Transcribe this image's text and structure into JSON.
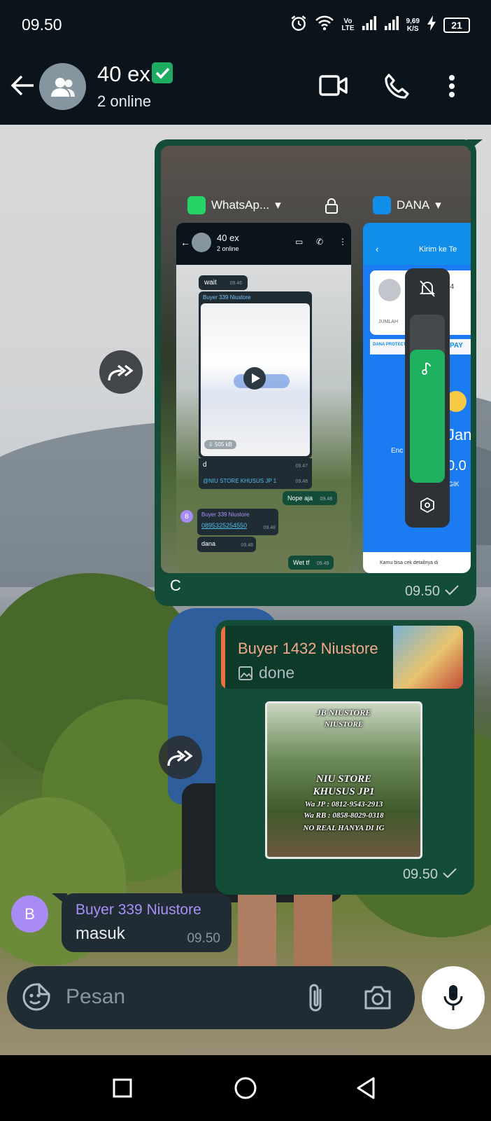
{
  "status_bar": {
    "time": "09.50",
    "network_label_top": "Vo",
    "network_label_bottom": "LTE",
    "speed_value": "9,69",
    "speed_unit": "K/S",
    "battery": "21"
  },
  "header": {
    "title": "40 ex",
    "subtitle": "2 online"
  },
  "messages": {
    "forwarded_screenshot": {
      "tabs": {
        "left": "WhatsAp...",
        "right": "DANA"
      },
      "inner_chat": {
        "title": "40 ex",
        "subtitle": "2 online",
        "msg_wait": "wait",
        "msg_wait_time": "09.46",
        "video_sender": "Buyer 339 Niustore",
        "video_size": "505 kB",
        "msg_d": "d",
        "msg_d_time": "09.47",
        "msg_niu": "@NIU STORE KHUSUS JP 1",
        "msg_niu_time": "09.48",
        "msg_nope": "Nope aja",
        "msg_nope_time": "09.48",
        "buyer_name": "Buyer 339 Niustore",
        "buyer_phone": "0895325254550",
        "buyer_phone_time": "09.48",
        "msg_dana": "dana",
        "msg_dana_time": "09.48",
        "msg_wet": "Wet tf",
        "msg_wet_time": "09.49",
        "avatar_letter": "B"
      },
      "dana_card": {
        "title": "Kirim ke Te",
        "id_suffix": "2-54",
        "amount_label": "JUMLAH",
        "protect": "DANA PROTECTION",
        "pay": "PAY",
        "balance_label": "Jan",
        "enter_label": "Enc",
        "right_val": "0.0",
        "gik": "GIK",
        "footer": "Kamu bisa cek detailnya di"
      },
      "caption": "C",
      "time": "09.50"
    },
    "reply_message": {
      "quote_name": "Buyer 1432 Niustore",
      "quote_text": "done",
      "promo": {
        "line1": "JB NIUSTORE",
        "line2": "NIUSTORE",
        "line3": "NIU STORE",
        "line4": "KHUSUS JP1",
        "line5": "Wa JP : 0812-9543-2913",
        "line6": "Wa RB : 0858-8029-0318",
        "line7": "NO REAL HANYA DI IG"
      },
      "time": "09.50"
    },
    "incoming": {
      "avatar_letter": "B",
      "sender": "Buyer 339 Niustore",
      "text": "masuk",
      "time": "09.50"
    }
  },
  "input": {
    "placeholder": "Pesan"
  },
  "colors": {
    "header_bg": "#0b141a",
    "outgoing_bubble": "#144d37",
    "incoming_bubble": "#1f2c34",
    "accent_green": "#1daa61",
    "sender_purple": "#a891f7",
    "quote_orange": "#e8743b"
  }
}
